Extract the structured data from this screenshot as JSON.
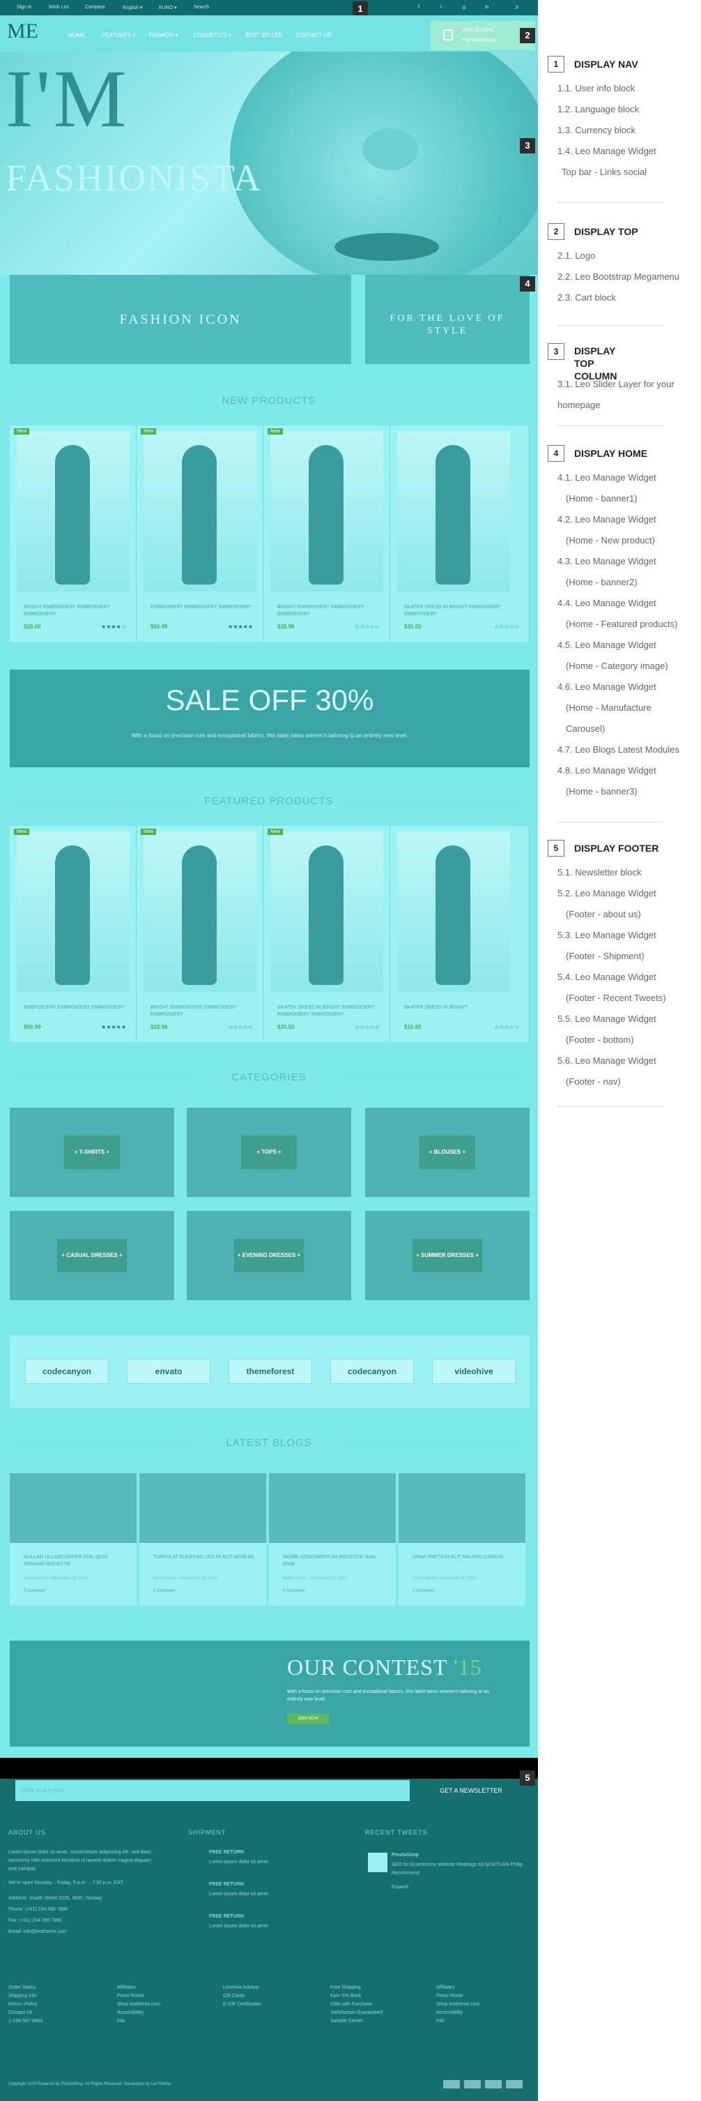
{
  "topbar": {
    "links": [
      "Sign in",
      "Wish List",
      "Compare",
      "English ▾",
      "EURO ▾",
      "Search"
    ],
    "social": [
      "f",
      "t",
      "g",
      "in",
      "p"
    ]
  },
  "header": {
    "logo": "ME",
    "menu": [
      "HOME",
      "FEATURES ▾",
      "FASHION ▾",
      "COSMETICS ▾",
      "BEST SELLER",
      "CONTACT US"
    ],
    "cart_title": "Item (0 Item)",
    "cart_sub": "Free shipping day"
  },
  "badges": [
    "1",
    "2",
    "3",
    "4",
    "5"
  ],
  "hero": {
    "line1": "I'M",
    "line2": "FASHIONISTA"
  },
  "banners": {
    "left": "FASHION ICON",
    "right": "FOR THE LOVE OF STYLE"
  },
  "new_products": {
    "title": "NEW PRODUCTS",
    "items": [
      {
        "badge": "New",
        "name": "BRIGHT EMBROIDERY EMBROIDERY EMBROIDERY",
        "price": "$28.00",
        "stars": "★★★★☆"
      },
      {
        "badge": "New",
        "name": "EMBROIDERY EMBROIDERY EMBROIDERY",
        "price": "$50.99",
        "stars": "★★★★★"
      },
      {
        "badge": "New",
        "name": "BRIGHT EMBROIDERY EMBROIDERY EMBROIDERY",
        "price": "$28.98",
        "stars": "☆☆☆☆☆"
      },
      {
        "badge": "",
        "name": "SKATER DRESS IN BRIGHT EMBROIDERY EMBROIDERY",
        "price": "$30.50",
        "stars": "☆☆☆☆☆"
      }
    ]
  },
  "sale": {
    "title": "SALE OFF 30%",
    "text": "With a focus on precision cuts and exceptional fabrics, this label takes women's tailoring to an entirely new level."
  },
  "featured_products": {
    "title": "FEATURED PRODUCTS",
    "items": [
      {
        "badge": "New",
        "name": "EMBROIDERY EMBROIDERY EMBROIDERY",
        "price": "$50.99",
        "stars": "★★★★★"
      },
      {
        "badge": "New",
        "name": "BRIGHT EMBROIDERY EMBROIDERY EMBROIDERY",
        "price": "$28.98",
        "stars": "☆☆☆☆☆"
      },
      {
        "badge": "New",
        "name": "SKATER DRESS IN BRIGHT EMBROIDERY EMBROIDERY EMBROIDERY",
        "price": "$30.50",
        "stars": "☆☆☆☆☆"
      },
      {
        "badge": "",
        "name": "SKATER DRESS IN BRIGHT",
        "price": "$16.80",
        "stars": "☆☆☆☆☆"
      }
    ]
  },
  "categories": {
    "title": "CATEGORIES",
    "items": [
      "+ T-SHIRTS +",
      "+ TOPS +",
      "+ BLOUSES +",
      "+ CASUAL DRESSES +",
      "+ EVENING DRESSES +",
      "+ SUMMER DRESSES +"
    ]
  },
  "brands": [
    "codecanyon",
    "envato",
    "themeforest",
    "codecanyon",
    "videohive"
  ],
  "blogs": {
    "title": "LATEST BLOGS",
    "items": [
      {
        "title": "NULLAM ULLAMCORPER NISL QUIS ORNARE MOLESTIE",
        "date": "Demo Demo - December 22, 2015",
        "comments": "0 Comment"
      },
      {
        "title": "TURPIS AT ELEIFEND LEO MI ELIT AENEAN",
        "date": "Demo Demo - December 22, 2015",
        "comments": "0 Comment"
      },
      {
        "title": "MORBI CONDIMENTUM MOLESTIE NAM ENIM",
        "date": "Demo Demo - December 22, 2015",
        "comments": "0 Comment"
      },
      {
        "title": "URNA PRETIUM ELIT MAURIS CURSUS",
        "date": "Demo Demo - December 22, 2015",
        "comments": "0 Comment"
      }
    ]
  },
  "contest": {
    "title": "OUR CONTEST",
    "year": "'15",
    "text": "With a focus on precision cuts and exceptional fabrics, this label takes women's tailoring to an entirely new level.",
    "button": "JOIN NOW"
  },
  "newsletter": {
    "placeholder": "Enter your e-mail",
    "button": "GET A NEWSLETTER"
  },
  "footer": {
    "about_title": "ABOUT US",
    "about_text": "Lorem ipsum dolor sit amet, consectetuer adipiscing elit, sed diam nonummy nibh euismod tincidunt ut laoreet dolore magna aliquam erat volutpat.",
    "hours": "We're open Monday – Friday, 9 a.m. – 7:30 p.m. EST",
    "address": "Address: Snaith Street 322b, 4000, Norway",
    "phone": "Phone: (+01) 234 556 7890",
    "fax": "Fax: (+01) 234 556 7890",
    "email": "Email: info@leotheme.com",
    "shipment_title": "SHIPMENT",
    "shipment_items": [
      {
        "title": "FREE RETURN",
        "text": "Lorem ipsum dolor sit amet"
      },
      {
        "title": "FREE RETURN",
        "text": "Lorem ipsum dolor sit amet"
      },
      {
        "title": "FREE RETURN",
        "text": "Lorem ipsum dolor sit amet"
      }
    ],
    "tweets_title": "RECENT TWEETS",
    "tweet_user": "PrestaShop",
    "tweet_text": "SEO for Ecommerce Website Redesign bit.ly/1KTUAN Philip Recommend",
    "tweet_meta": "Expand",
    "cols": [
      [
        "Order Status",
        "Shipping Info",
        "Return Policy",
        "Contact Us",
        "1-234-567-8901"
      ],
      [
        "Affiliates",
        "Press Room",
        "Shop leotheme.com",
        "Accessibility",
        "Info"
      ],
      [
        "Leoemia Advisor",
        "Gift Cards",
        "E-Gift Certificates",
        "",
        ""
      ],
      [
        "Free Shipping",
        "Earn 5% Back",
        "Gifts with Purchase",
        "Satisfaction Guaranteed",
        "Sample Center"
      ],
      [
        "Affiliates",
        "Press Room",
        "Shop leotheme.com",
        "Accessibility",
        "Info"
      ]
    ],
    "copyright": "Copyright 2015 Powered by PrestaShop. All Rights Reserved. Developed by LeoTheme"
  },
  "sidebar": [
    {
      "num": "1",
      "title": "DISPLAY NAV",
      "items": [
        "1.1. User info block",
        "1.2. Language block",
        "1.3. Currency block",
        "1.4. Leo Manage Widget",
        "Top bar - Links social"
      ]
    },
    {
      "num": "2",
      "title": "DISPLAY TOP",
      "items": [
        "2.1. Logo",
        "2.2. Leo Bootstrap Megamenu",
        "2.3. Cart block"
      ]
    },
    {
      "num": "3",
      "title": "DISPLAY TOP COLUMN",
      "items": [
        "3.1. Leo Slider Layer for your",
        "homepage"
      ]
    },
    {
      "num": "4",
      "title": "DISPLAY HOME",
      "items": [
        "4.1. Leo Manage Widget",
        "(Home - banner1)",
        "4.2. Leo Manage Widget",
        "(Home - New product)",
        "4.3. Leo Manage Widget",
        "(Home - banner2)",
        "4.4. Leo Manage Widget",
        "(Home - Featured products)",
        "4.5. Leo Manage Widget",
        "(Home - Category image)",
        "4.6. Leo Manage Widget",
        "(Home - Manufacture",
        "Carousel)",
        "4.7. Leo Blogs Latest Modules",
        "4.8. Leo Manage Widget",
        "(Home - banner3)"
      ]
    },
    {
      "num": "5",
      "title": "DISPLAY FOOTER",
      "items": [
        "5.1. Newsletter block",
        "5.2. Leo Manage Widget",
        "(Footer - about us)",
        "5.3. Leo Manage Widget",
        "(Footer - Shipment)",
        "5.4. Leo Manage Widget",
        "(Footer - Recent Tweets)",
        "5.5. Leo Manage Widget",
        "(Footer - bottom)",
        "5.6. Leo Manage Widget",
        "(Footer - nav)"
      ]
    }
  ]
}
